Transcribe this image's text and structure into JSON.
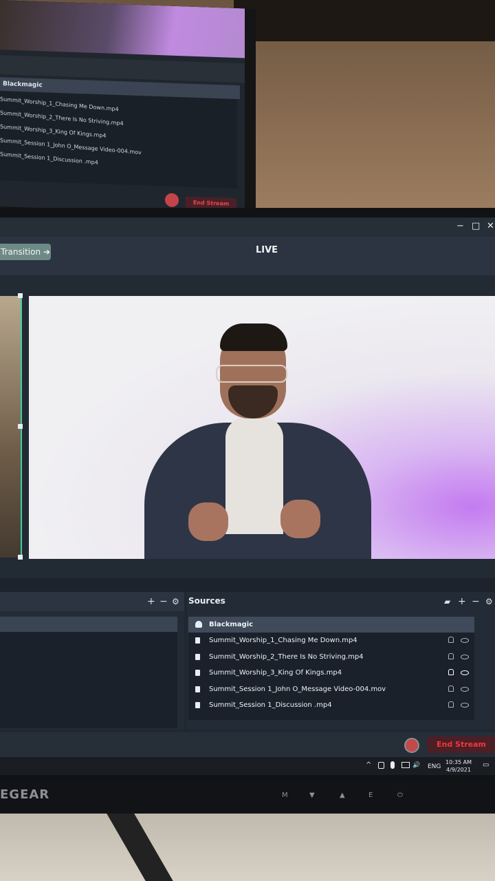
{
  "background_monitor": {
    "source_header": "Blackmagic",
    "sources": [
      "Summit_Worship_1_Chasing Me Down.mp4",
      "Summit_Worship_2_There Is No Striving.mp4",
      "Summit_Worship_3_King Of Kings.mp4",
      "Summit_Session 1_John O_Message Video-004.mov",
      "Summit_Session 1_Discussion .mp4"
    ],
    "end_stream_label": "End Stream"
  },
  "window": {
    "minimize": "−",
    "maximize": "□",
    "close": "✕"
  },
  "toolbar": {
    "transition_label": "Transition ➔",
    "live_label": "LIVE"
  },
  "scenes_panel": {
    "add": "+",
    "remove": "−",
    "settings": "⚙"
  },
  "sources_panel": {
    "title": "Sources",
    "add": "+",
    "remove": "−",
    "settings": "⚙",
    "folder": "▰",
    "header_item": "Blackmagic",
    "items": [
      "Summit_Worship_1_Chasing Me Down.mp4",
      "Summit_Worship_2_There Is No Striving.mp4",
      "Summit_Worship_3_King Of Kings.mp4",
      "Summit_Session 1_John O_Message Video-004.mov",
      "Summit_Session 1_Discussion .mp4"
    ]
  },
  "controls": {
    "end_stream_label": "End Stream"
  },
  "taskbar": {
    "chevron": "^",
    "volume": "🔊",
    "language": "ENG",
    "time": "10:35 AM",
    "date": "4/9/2021",
    "notification": "▭"
  },
  "bezel": {
    "brand": "EGEAR",
    "btn_m": "M",
    "btn_down": "▼",
    "btn_up": "▲",
    "btn_e": "E",
    "btn_power": "⏻"
  },
  "colors": {
    "accent_transition": "#6d8a86",
    "end_stream_text": "#ee3a3a",
    "preview_border": "#3fd0a0"
  }
}
